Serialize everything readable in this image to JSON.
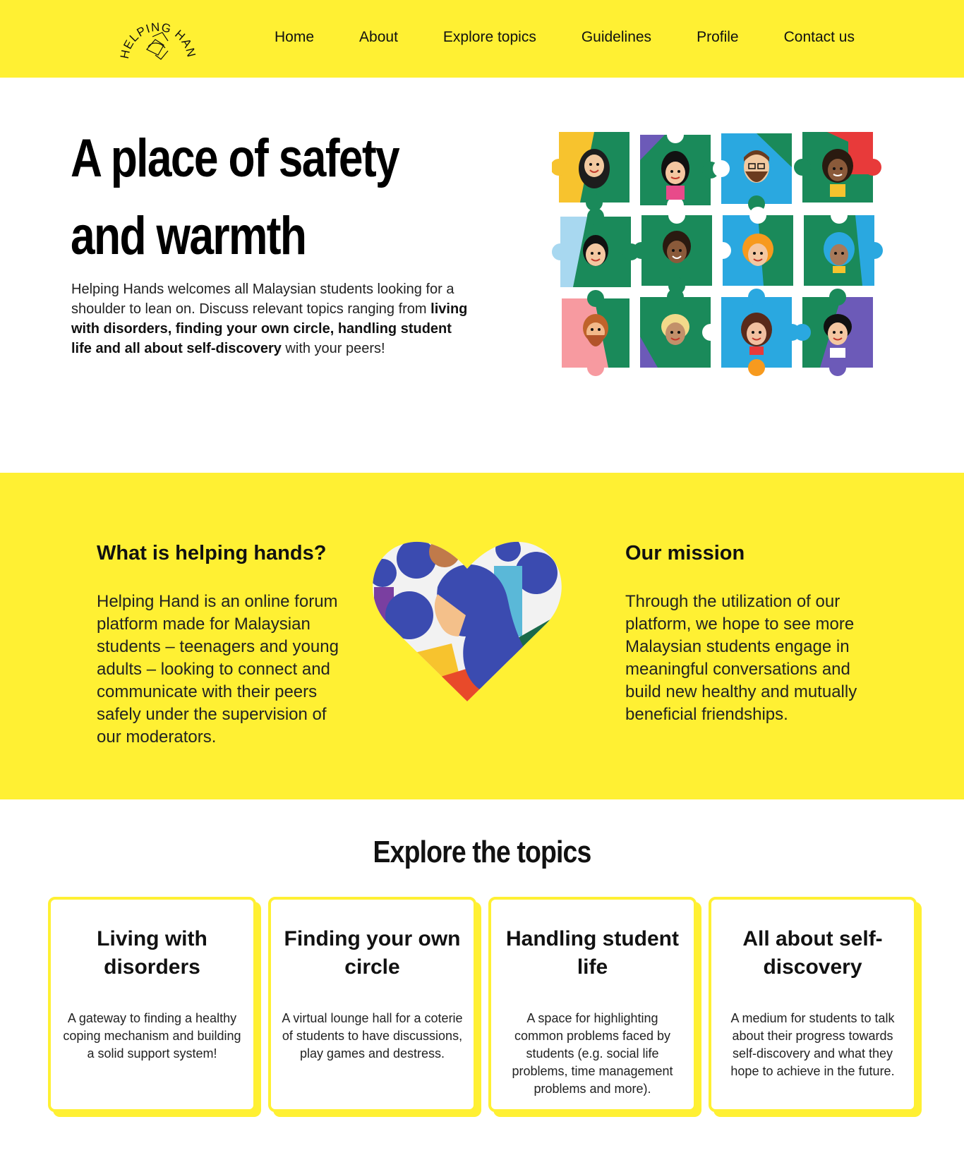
{
  "brand": {
    "logo_text": "HELPING HANDS"
  },
  "nav": {
    "items": [
      {
        "label": "Home"
      },
      {
        "label": "About"
      },
      {
        "label": "Explore topics"
      },
      {
        "label": "Guidelines"
      },
      {
        "label": "Profile"
      },
      {
        "label": "Contact us"
      }
    ]
  },
  "hero": {
    "title_line1": "A place of safety",
    "title_line2": "and warmth",
    "text_intro": "Helping Hands welcomes all Malaysian students looking for a shoulder to lean on. Discuss relevant topics ranging from ",
    "text_bold": "living with disorders, finding your own circle, handling student life and all about self-discovery",
    "text_outro": " with your peers!"
  },
  "about": {
    "what_title": "What is helping hands?",
    "what_text": "Helping Hand is an online forum platform made for Malaysian students – teenagers and young adults – looking to connect and communicate with their peers safely under the supervision of our moderators.",
    "mission_title": "Our mission",
    "mission_text": "Through the utilization of our platform, we hope to see more Malaysian students engage in meaningful conversations and build new healthy and mutually beneficial friendships."
  },
  "topics": {
    "title": "Explore the topics",
    "cards": [
      {
        "title": "Living with disorders",
        "text": "A gateway to finding a healthy coping mechanism and building a solid support system!"
      },
      {
        "title": "Finding your own circle",
        "text": "A virtual lounge hall for a coterie of students to have discussions, play games and destress."
      },
      {
        "title": "Handling student life",
        "text": "A space for highlighting common problems faced by students (e.g. social life problems, time management problems and more)."
      },
      {
        "title": "All about self-discovery",
        "text": "A medium for students to talk about their progress towards self-discovery and what they hope to achieve in the future."
      }
    ]
  },
  "colors": {
    "brand_yellow": "#fff033",
    "puzzle_green": "#1a8a5a",
    "puzzle_blue": "#2aa8e0",
    "heart_blue": "#3b4bb0",
    "heart_red": "#e84a2a"
  }
}
